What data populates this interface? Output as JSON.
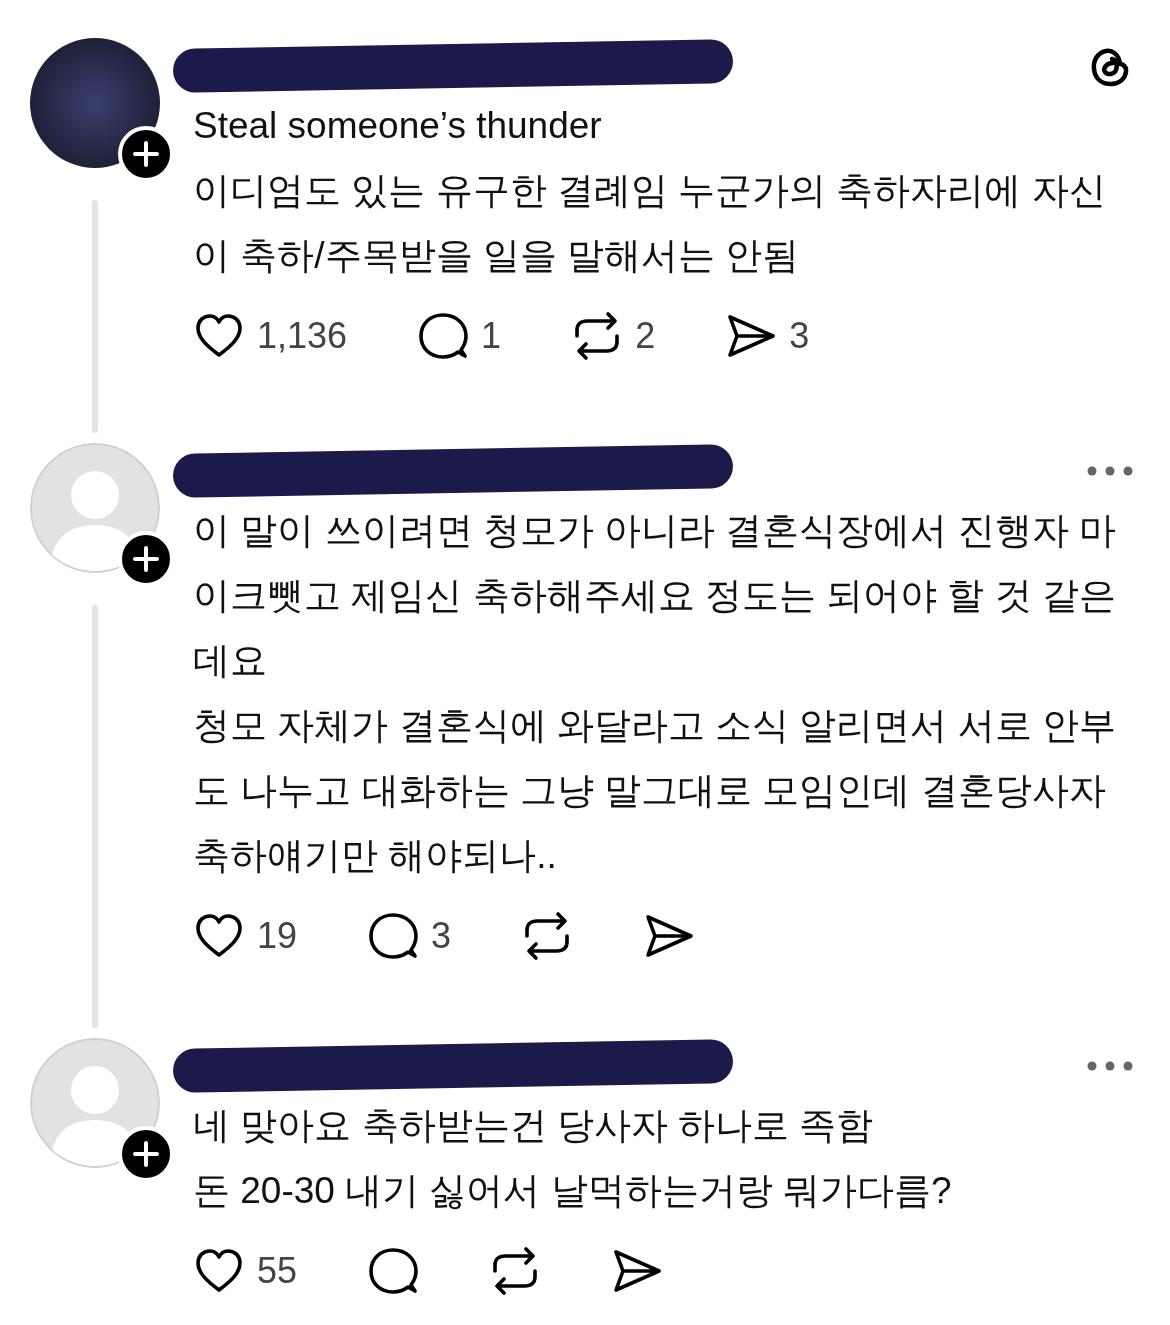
{
  "posts": [
    {
      "avatar": {
        "kind": "photo"
      },
      "header_icon": {
        "kind": "logo"
      },
      "title": "Steal someone’s thunder",
      "paragraphs": [
        "이디엄도 있는 유구한 결례임 누군가의 축하자리에 자신이 축하/주목받을 일을 말해서는 안됨"
      ],
      "thread_line": true,
      "actions": [
        {
          "kind": "like",
          "count": "1,136"
        },
        {
          "kind": "reply",
          "count": "1"
        },
        {
          "kind": "repost",
          "count": "2"
        },
        {
          "kind": "share",
          "count": "3"
        }
      ]
    },
    {
      "avatar": {
        "kind": "default"
      },
      "header_icon": {
        "kind": "more"
      },
      "paragraphs": [
        "이 말이 쓰이려면 청모가 아니라 결혼식장에서 진행자 마이크뺏고 제임신 축하해주세요 정도는 되어야 할 것 같은데요",
        "청모 자체가 결혼식에 와달라고 소식 알리면서 서로 안부도 나누고 대화하는 그냥 말그대로 모임인데 결혼당사자 축하얘기만 해야되나.."
      ],
      "thread_line": true,
      "actions": [
        {
          "kind": "like",
          "count": "19"
        },
        {
          "kind": "reply",
          "count": "3"
        },
        {
          "kind": "repost"
        },
        {
          "kind": "share"
        }
      ]
    },
    {
      "avatar": {
        "kind": "default"
      },
      "header_icon": {
        "kind": "more"
      },
      "paragraphs": [
        "네 맞아요 축하받는건 당사자 하나로 족함",
        "돈 20-30 내기 싫어서 날먹하는거랑 뭐가다름?"
      ],
      "thread_line": false,
      "actions": [
        {
          "kind": "like",
          "count": "55"
        },
        {
          "kind": "reply"
        },
        {
          "kind": "repost"
        },
        {
          "kind": "share"
        }
      ]
    }
  ]
}
